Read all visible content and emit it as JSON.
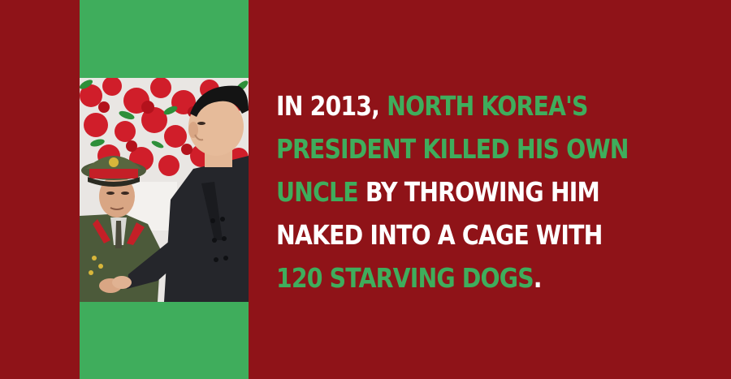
{
  "colors": {
    "background": "#8f1318",
    "accent_green": "#3fad5c",
    "text_white": "#ffffff"
  },
  "fact": {
    "line1_white": "In 2013, ",
    "line1_green": "North Korea's",
    "line2_green": "president killed his own",
    "line3_green": "uncle",
    "line3_white": " by throwing him",
    "line4_white": "naked into a cage with",
    "line5_green": "120 starving dogs",
    "line5_white": "."
  }
}
